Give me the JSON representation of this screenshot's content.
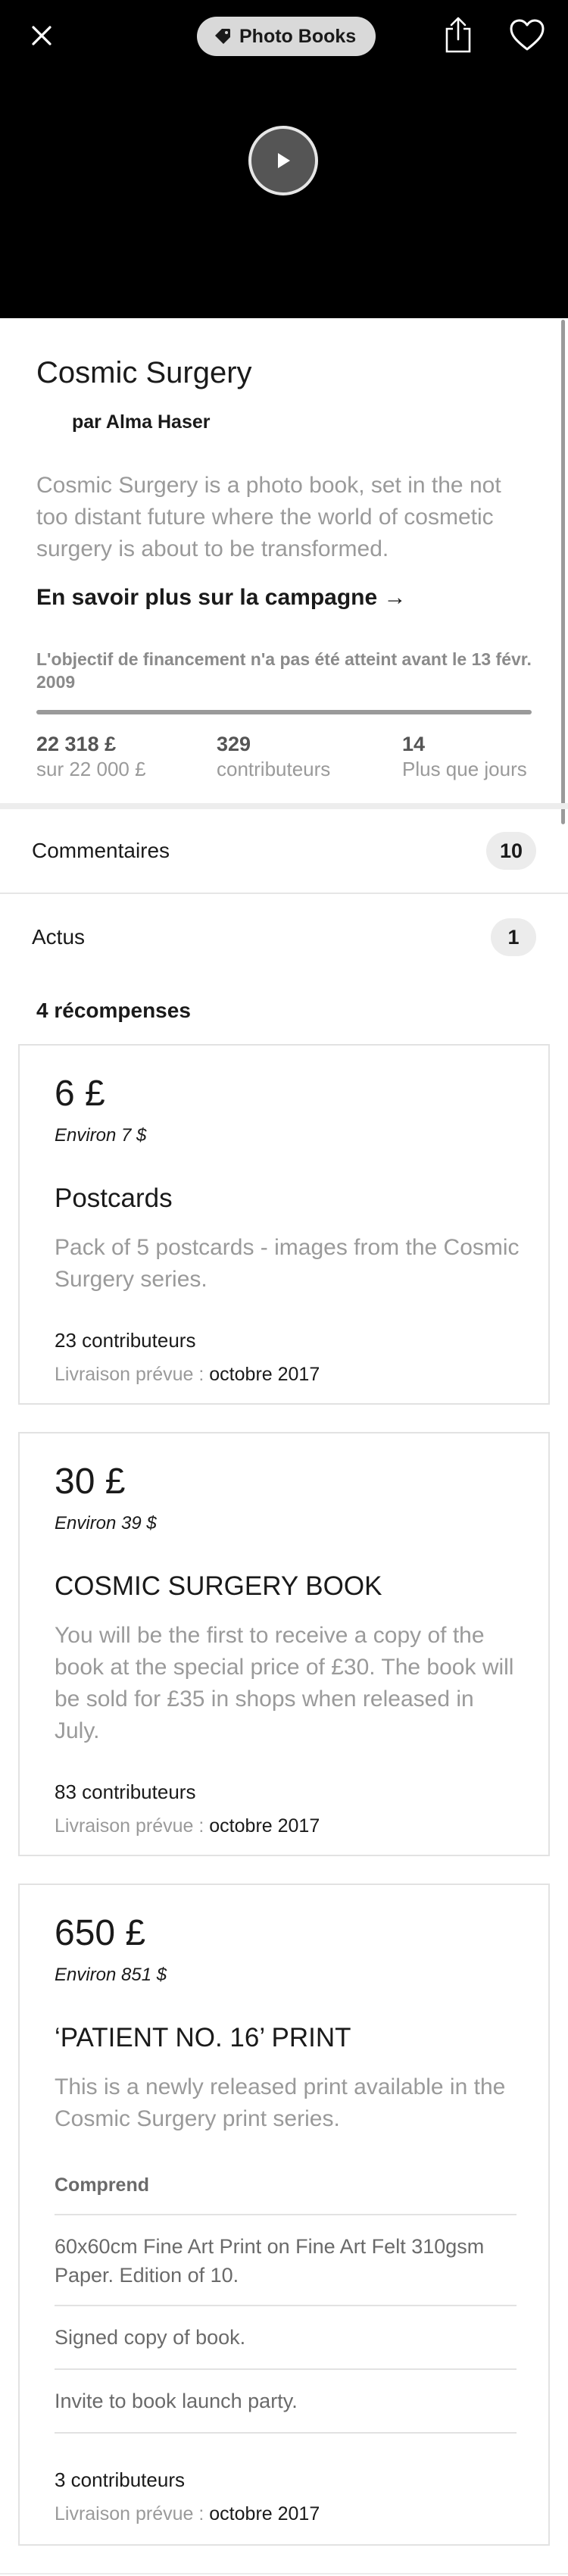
{
  "header": {
    "category": "Photo Books",
    "icons": [
      "close-icon",
      "tag-icon",
      "share-icon",
      "heart-icon",
      "play-icon"
    ]
  },
  "project": {
    "title": "Cosmic Surgery",
    "creator": "par Alma Haser",
    "blurb": "Cosmic Surgery is a photo book, set in the not too distant future where the world of cosmetic surgery is about to be transformed.",
    "campaign_link": "En savoir plus sur la campagne →",
    "funding_note": "L'objectif de financement n'a pas été atteint avant le 13 févr. 2009",
    "progress": 1.0,
    "stats": {
      "pledged_value": "22 318 £",
      "pledged_label": "sur 22 000 £",
      "backers_value": "329",
      "backers_label": "contributeurs",
      "days_value": "14",
      "days_label": "Plus que jours"
    }
  },
  "rows": {
    "comments_label": "Commentaires",
    "comments_count": "10",
    "updates_label": "Actus",
    "updates_count": "1"
  },
  "rewards_heading": "4 récompenses",
  "rewards": [
    {
      "price": "6 £",
      "approx": "Environ 7 $",
      "title": "Postcards",
      "description": "Pack of 5 postcards - images from the Cosmic Surgery series.",
      "backers": "23 contributeurs",
      "delivery_label": "Livraison prévue : ",
      "delivery_date": "octobre 2017"
    },
    {
      "price": "30 £",
      "approx": "Environ 39 $",
      "title": "COSMIC SURGERY BOOK",
      "description": "You will be the first to receive a copy of the book at the special price of £30. The book will be sold for £35 in shops when released in July.",
      "backers": "83 contributeurs",
      "delivery_label": "Livraison prévue : ",
      "delivery_date": "octobre 2017"
    },
    {
      "price": "650 £",
      "approx": "Environ 851 $",
      "title": "‘PATIENT NO. 16’ PRINT",
      "description": "This is a newly released print available in the Cosmic Surgery print series.",
      "includes_label": "Comprend",
      "includes": [
        "60x60cm Fine Art Print on Fine Art Felt 310gsm Paper. Edition of 10.",
        "Signed copy of book.",
        "Invite to book launch party."
      ],
      "backers": "3 contributeurs",
      "delivery_label": "Livraison prévue : ",
      "delivery_date": "octobre 2017"
    }
  ]
}
